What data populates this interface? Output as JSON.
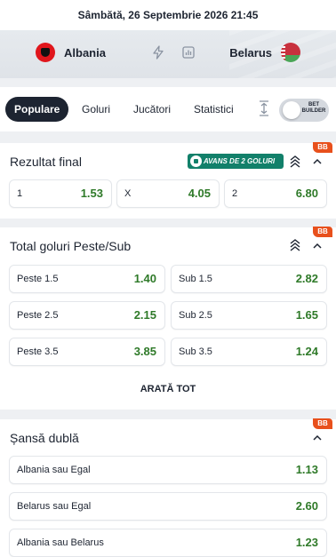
{
  "header": {
    "datetime": "Sâmbătă, 26 Septembrie 2026 21:45"
  },
  "match": {
    "home": {
      "name": "Albania",
      "flag": "albania-flag"
    },
    "away": {
      "name": "Belarus",
      "flag": "belarus-flag"
    },
    "icons": [
      "lightning-icon",
      "stats-icon"
    ]
  },
  "tabs": [
    {
      "label": "Populare",
      "active": true
    },
    {
      "label": "Goluri",
      "active": false
    },
    {
      "label": "Jucători",
      "active": false
    },
    {
      "label": "Statistici",
      "active": false
    }
  ],
  "bet_builder": {
    "label_line1": "BET",
    "label_line2": "BUILDER",
    "enabled": false
  },
  "markets": {
    "final_result": {
      "title": "Rezultat final",
      "badge": "BB",
      "promo": "AVANS DE 2 GOLURI",
      "odds": [
        {
          "label": "1",
          "value": "1.53"
        },
        {
          "label": "X",
          "value": "4.05"
        },
        {
          "label": "2",
          "value": "6.80"
        }
      ]
    },
    "total_goals": {
      "title": "Total goluri Peste/Sub",
      "badge": "BB",
      "odds": [
        {
          "label": "Peste 1.5",
          "value": "1.40"
        },
        {
          "label": "Sub 1.5",
          "value": "2.82"
        },
        {
          "label": "Peste 2.5",
          "value": "2.15"
        },
        {
          "label": "Sub 2.5",
          "value": "1.65"
        },
        {
          "label": "Peste 3.5",
          "value": "3.85"
        },
        {
          "label": "Sub 3.5",
          "value": "1.24"
        }
      ],
      "show_all": "ARATĂ TOT"
    },
    "double_chance": {
      "title": "Șansă dublă",
      "badge": "BB",
      "odds": [
        {
          "label": "Albania sau Egal",
          "value": "1.13"
        },
        {
          "label": "Belarus sau Egal",
          "value": "2.60"
        },
        {
          "label": "Albania sau Belarus",
          "value": "1.23"
        }
      ]
    }
  },
  "colors": {
    "odd_value": "#2f7a29",
    "active_tab": "#1d2431",
    "bb_badge": "#e8501c",
    "promo": "#12806a"
  }
}
